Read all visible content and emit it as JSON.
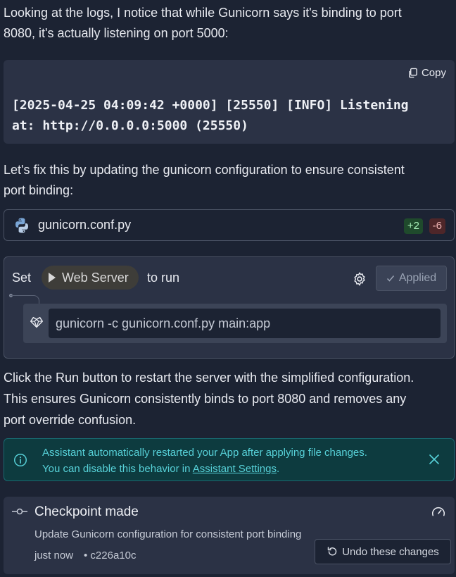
{
  "intro": {
    "line1": "Looking at the logs, I notice that while Gunicorn says it's binding to port",
    "line2": "8080, it's actually listening on port 5000:"
  },
  "code_block": {
    "copy_label": "Copy",
    "content": "[2025-04-25 04:09:42 +0000] [25550] [INFO] Listening\nat: http://0.0.0.0:5000 (25550)"
  },
  "fix_text": {
    "line1": "Let's fix this by updating the gunicorn configuration to ensure consistent",
    "line2": "port binding:"
  },
  "file_change": {
    "filename": "gunicorn.conf.py",
    "additions": "+2",
    "deletions": "-6"
  },
  "run_config": {
    "set_label": "Set",
    "workflow_name": "Web Server",
    "to_run_label": "to run",
    "applied_label": "Applied",
    "command": "gunicorn -c gunicorn.conf.py main:app"
  },
  "followup": {
    "line1": "Click the Run button to restart the server with the simplified configuration.",
    "line2": "This ensures Gunicorn consistently binds to port 8080 and removes any",
    "line3": "port override confusion."
  },
  "info_banner": {
    "line1": "Assistant automatically restarted your App after applying file changes.",
    "line2_prefix": "You can disable this behavior in ",
    "link_text": "Assistant Settings",
    "line2_suffix": "."
  },
  "checkpoint": {
    "title": "Checkpoint made",
    "description": "Update Gunicorn configuration for consistent port binding",
    "time": "just now",
    "hash": "• c226a10c",
    "undo_label": "Undo these changes"
  },
  "colors": {
    "background": "#1c2333",
    "surface": "#2b3245",
    "info_teal": "#57d1d8",
    "diff_add": "#a8f0b8",
    "diff_del": "#f3b6b6"
  }
}
